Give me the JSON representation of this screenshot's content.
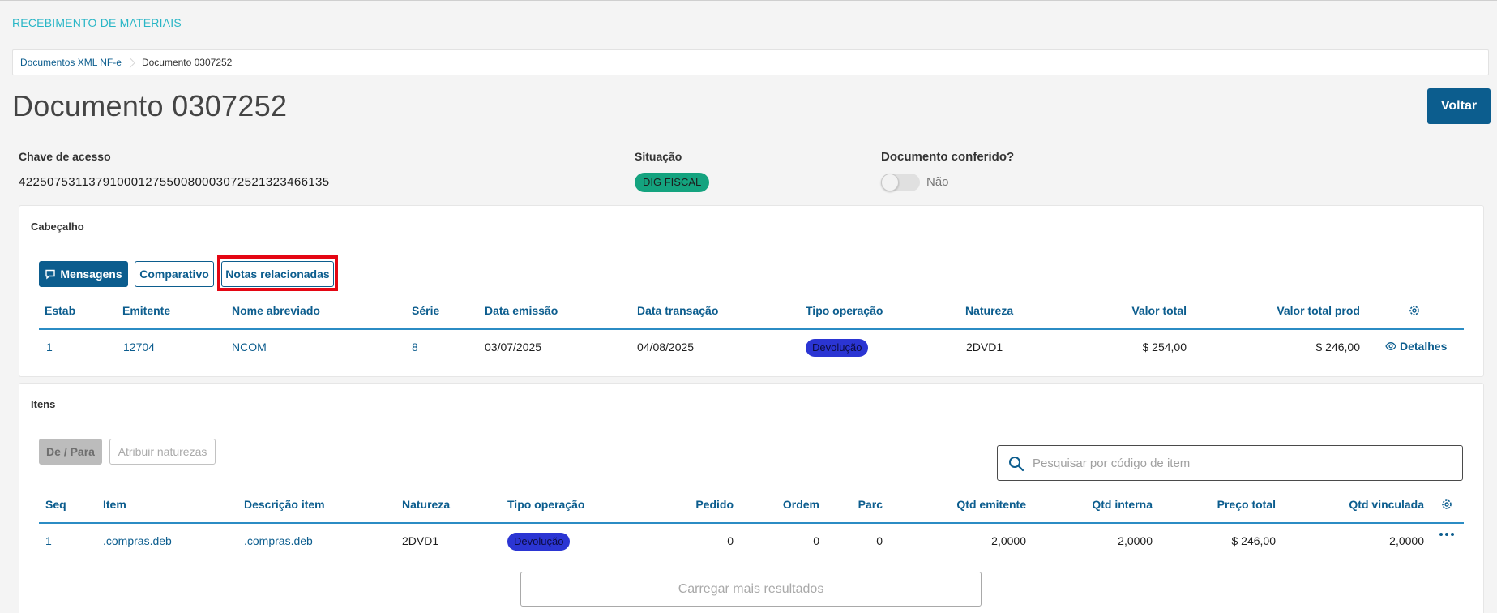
{
  "app": {
    "title": "RECEBIMENTO DE MATERIAIS"
  },
  "breadcrumb": {
    "items": [
      "Documentos XML NF-e",
      "Documento 0307252"
    ]
  },
  "page": {
    "title": "Documento 0307252",
    "back_label": "Voltar"
  },
  "summary": {
    "access_key_label": "Chave de acesso",
    "access_key_value": "42250753113791000127550080003072521323466135",
    "status_label": "Situação",
    "status_value": "DIG FISCAL",
    "checked_label": "Documento conferido?",
    "checked_value": "Não",
    "checked_on": false
  },
  "header_card": {
    "title": "Cabeçalho",
    "buttons": {
      "messages": "Mensagens",
      "compare": "Comparativo",
      "related": "Notas relacionadas"
    },
    "columns": [
      "Estab",
      "Emitente",
      "Nome abreviado",
      "Série",
      "Data emissão",
      "Data transação",
      "Tipo operação",
      "Natureza",
      "Valor total",
      "Valor total prod"
    ],
    "row": {
      "estab": "1",
      "emitente": "12704",
      "nome": "NCOM",
      "serie": "8",
      "data_emissao": "03/07/2025",
      "data_transacao": "04/08/2025",
      "tipo_operacao": "Devolução",
      "natureza": "2DVD1",
      "valor_total": "$ 254,00",
      "valor_total_prod": "$ 246,00",
      "details_label": "Detalhes"
    }
  },
  "items_card": {
    "title": "Itens",
    "buttons": {
      "de_para": "De / Para",
      "assign": "Atribuir naturezas"
    },
    "search": {
      "placeholder": "Pesquisar por código de item",
      "value": ""
    },
    "columns": [
      "Seq",
      "Item",
      "Descrição item",
      "Natureza",
      "Tipo operação",
      "Pedido",
      "Ordem",
      "Parc",
      "Qtd emitente",
      "Qtd interna",
      "Preço total",
      "Qtd vinculada"
    ],
    "rows": [
      {
        "seq": "1",
        "item": ".compras.deb",
        "descricao": ".compras.deb",
        "natureza": "2DVD1",
        "tipo_operacao": "Devolução",
        "pedido": "0",
        "ordem": "0",
        "parc": "0",
        "qtd_emitente": "2,0000",
        "qtd_interna": "2,0000",
        "preco_total": "$ 246,00",
        "qtd_vinculada": "2,0000"
      }
    ],
    "load_more": "Carregar mais resultados"
  },
  "colors": {
    "primary": "#0c5d8e",
    "accent_title": "#29b6c6",
    "status_green": "#14a37f",
    "tag_blue": "#2b35d3",
    "highlight_red": "#e40613"
  },
  "icons": [
    "chat-icon",
    "gear-icon",
    "eye-icon",
    "search-icon",
    "more-icon"
  ]
}
